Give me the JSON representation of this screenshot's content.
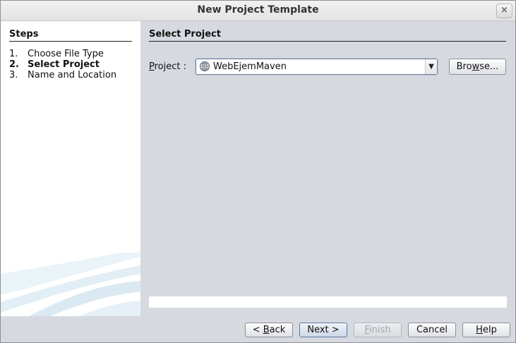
{
  "window": {
    "title": "New Project Template"
  },
  "steps": {
    "title": "Steps",
    "items": [
      {
        "num": "1.",
        "label": "Choose File Type"
      },
      {
        "num": "2.",
        "label": "Select Project"
      },
      {
        "num": "3.",
        "label": "Name and Location"
      }
    ]
  },
  "content": {
    "title": "Select Project",
    "project_label": "Project :",
    "project_value": "WebEjemMaven",
    "browse_label": "Browse..."
  },
  "buttons": {
    "back": "< Back",
    "next": "Next >",
    "finish": "Finish",
    "cancel": "Cancel",
    "help": "Help"
  },
  "icons": {
    "close": "close-icon",
    "project": "globe-icon",
    "dropdown": "chevron-down-icon"
  }
}
